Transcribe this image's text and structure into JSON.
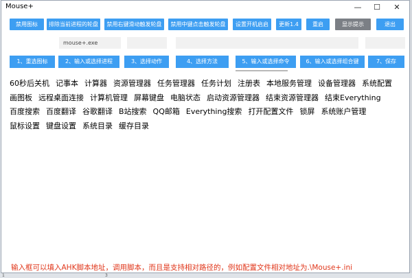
{
  "window": {
    "title": "Mouse+",
    "minimize": "—",
    "maximize": "☐",
    "close": "✕"
  },
  "top_buttons": [
    "禁用图标",
    "排除当前进程的轮盘",
    "禁用右键滑动触发轮盘",
    "禁用中键点击触发轮盘",
    "设置开机启启",
    "更新1.4",
    "重启",
    "显示提示",
    "退出"
  ],
  "fields": {
    "process_value": "mouse+.exe"
  },
  "steps": [
    "1、重选图标",
    "2、输入或选择进程",
    "3、选择动作",
    "4、选择方法",
    "5、输入或选择命令",
    "6、输入或选择组合键",
    "7、保存"
  ],
  "commands": [
    "60秒后关机",
    "记事本",
    "计算器",
    "资源管理器",
    "任务管理器",
    "任务计划",
    "注册表",
    "本地服务管理",
    "设备管理器",
    "系统配置",
    "画图板",
    "远程桌面连接",
    "计算机管理",
    "屏幕键盘",
    "电脑状态",
    "启动资源管理器",
    "结束资源管理器",
    "结束Everything",
    "百度搜索",
    "百度翻译",
    "谷歌翻译",
    "B站搜索",
    "QQ邮箱",
    "Everything搜索",
    "打开配置文件",
    "锁屏",
    "系统账户管理",
    "鼠标设置",
    "键盘设置",
    "系统目录",
    "缓存目录"
  ],
  "note": "输入框可以填入AHK脚本地址，调用脚本，而且是支持相对路径的，例如配置文件相对地址为.\\Mouse+.ini",
  "below_window": {
    "line_1": "1",
    "line_3": "3"
  }
}
